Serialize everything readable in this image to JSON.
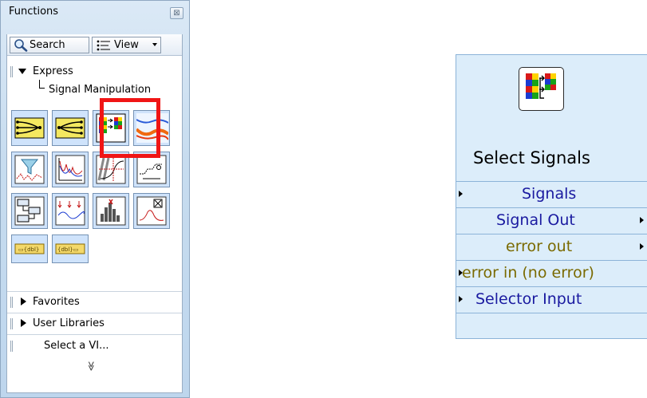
{
  "palette": {
    "title": "Functions",
    "close_glyph": "⊠",
    "toolbar": {
      "search_label": "Search",
      "view_label": "View"
    },
    "express": {
      "label": "Express",
      "sub_label": "Signal Manipulation"
    },
    "sections": [
      {
        "label": "Favorites"
      },
      {
        "label": "User Libraries"
      }
    ],
    "select_vi_label": "Select a VI...",
    "more_glyph": "≫",
    "icons": [
      "merge-signals-icon",
      "split-signals-icon",
      "select-signals-icon",
      "align-resample-icon",
      "filter-icon",
      "spectral-icon",
      "trigger-icon",
      "sample-compression-icon",
      "convert-to-dynamic-data-icon",
      "relay-signals-icon",
      "histogram-icon",
      "peak-detection-icon",
      "to-dds-icon",
      "from-dds-icon"
    ]
  },
  "node": {
    "title": "Select Signals",
    "terminals": [
      {
        "label": "Signals",
        "direction": "input",
        "color": "#1a1aa0"
      },
      {
        "label": "Signal Out",
        "direction": "output",
        "color": "#1a1aa0"
      },
      {
        "label": "error out",
        "direction": "output",
        "color": "#7a6a00"
      },
      {
        "label": "error in (no error)",
        "direction": "input",
        "color": "#7a6a00"
      },
      {
        "label": "Selector Input",
        "direction": "input",
        "color": "#1a1aa0"
      }
    ]
  },
  "colors": {
    "highlight": "#f01515",
    "node_bg": "#dcedfa",
    "palette_bg": "#c7dcef"
  }
}
